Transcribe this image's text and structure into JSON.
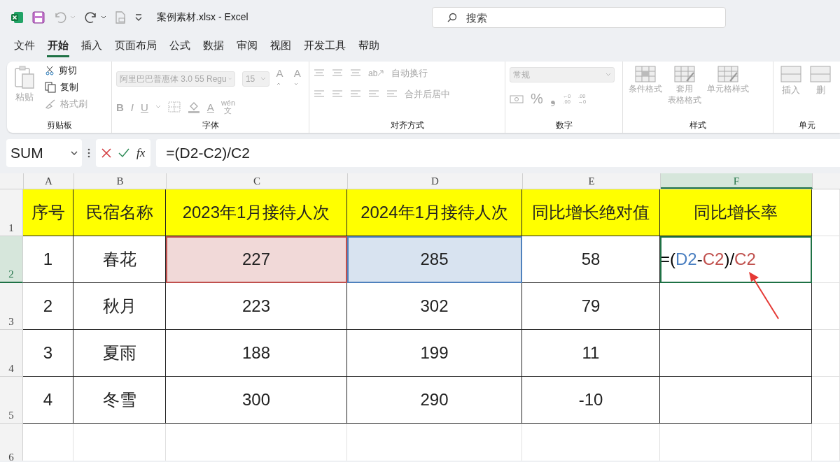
{
  "window": {
    "title": "案例素材.xlsx  -  Excel",
    "search": {
      "placeholder": "搜索"
    }
  },
  "menu_tabs": [
    {
      "label": "文件",
      "selected": false
    },
    {
      "label": "开始",
      "selected": true
    },
    {
      "label": "插入",
      "selected": false
    },
    {
      "label": "页面布局",
      "selected": false
    },
    {
      "label": "公式",
      "selected": false
    },
    {
      "label": "数据",
      "selected": false
    },
    {
      "label": "审阅",
      "selected": false
    },
    {
      "label": "视图",
      "selected": false
    },
    {
      "label": "开发工具",
      "selected": false
    },
    {
      "label": "帮助",
      "selected": false
    }
  ],
  "ribbon": {
    "clipboard": {
      "title": "剪贴板",
      "paste": {
        "label": "粘贴",
        "disabled": true
      },
      "items": [
        {
          "label": "剪切",
          "kind": "cut",
          "disabled": false
        },
        {
          "label": "复制",
          "kind": "copy",
          "disabled": false
        },
        {
          "label": "格式刷",
          "kind": "brush",
          "disabled": true
        }
      ]
    },
    "font": {
      "title": "字体",
      "font_name": "阿里巴巴普惠体 3.0 55 Regu",
      "font_size": "15",
      "grow": "A",
      "shrink": "A",
      "bold": "B",
      "italic": "I",
      "underline": "U",
      "font_color": "A",
      "phonetic": {
        "top": "wén",
        "bottom": "文"
      }
    },
    "alignment": {
      "title": "对齐方式",
      "wrap": "自动换行",
      "merge": "合并后居中",
      "orientation": "ab"
    },
    "number": {
      "title": "数字",
      "format": "常规",
      "percent": "%",
      "comma": "❟",
      "inc_decimal": [
        "←0",
        ".00"
      ],
      "dec_decimal": [
        ".00",
        "→0"
      ]
    },
    "styles": {
      "title": "样式",
      "items": [
        {
          "lines": [
            "条件格式"
          ],
          "kind": "conditional"
        },
        {
          "lines": [
            "套用",
            "表格格式"
          ],
          "kind": "table"
        },
        {
          "lines": [
            "单元格样式"
          ],
          "kind": "cell"
        }
      ]
    },
    "cells": {
      "title": "单元",
      "items": [
        {
          "label": "插入"
        },
        {
          "label": "删"
        }
      ]
    }
  },
  "formula_bar": {
    "name_box": "SUM",
    "fx": "fx",
    "value": "=(D2-C2)/C2"
  },
  "sheet": {
    "columns": [
      {
        "label": "A",
        "selected": false
      },
      {
        "label": "B",
        "selected": false
      },
      {
        "label": "C",
        "selected": false
      },
      {
        "label": "D",
        "selected": false
      },
      {
        "label": "E",
        "selected": false
      },
      {
        "label": "F",
        "selected": true
      }
    ],
    "header_row": {
      "number": "1",
      "selected": false,
      "cells": [
        "序号",
        "民宿名称",
        "2023年1月接待人次",
        "2024年1月接待人次",
        "同比增长绝对值",
        "同比增长率"
      ]
    },
    "rows": [
      {
        "number": "2",
        "selected": true,
        "cells": [
          {
            "text": "1"
          },
          {
            "text": "春花"
          },
          {
            "text": "227",
            "color": "#c0504d"
          },
          {
            "text": "285",
            "color": "#4f81bd"
          },
          {
            "text": "58"
          },
          {
            "editing": true,
            "tokens": [
              {
                "text": "=(",
                "color": "#000000"
              },
              {
                "text": "D2",
                "color": "#4a7fc1"
              },
              {
                "text": "-",
                "color": "#000000"
              },
              {
                "text": "C2",
                "color": "#c0504d"
              },
              {
                "text": ")/",
                "color": "#000000"
              },
              {
                "text": "C2",
                "color": "#c0504d"
              }
            ]
          }
        ]
      },
      {
        "number": "3",
        "selected": false,
        "cells": [
          {
            "text": "2"
          },
          {
            "text": "秋月"
          },
          {
            "text": "223"
          },
          {
            "text": "302"
          },
          {
            "text": "79"
          },
          {}
        ]
      },
      {
        "number": "4",
        "selected": false,
        "cells": [
          {
            "text": "3"
          },
          {
            "text": "夏雨"
          },
          {
            "text": "188"
          },
          {
            "text": "199"
          },
          {
            "text": "11"
          },
          {}
        ]
      },
      {
        "number": "5",
        "selected": false,
        "cells": [
          {
            "text": "4"
          },
          {
            "text": "冬雪"
          },
          {
            "text": "300"
          },
          {
            "text": "290"
          },
          {
            "text": "-10"
          },
          {}
        ]
      }
    ],
    "empty_rows": [
      "6"
    ]
  }
}
